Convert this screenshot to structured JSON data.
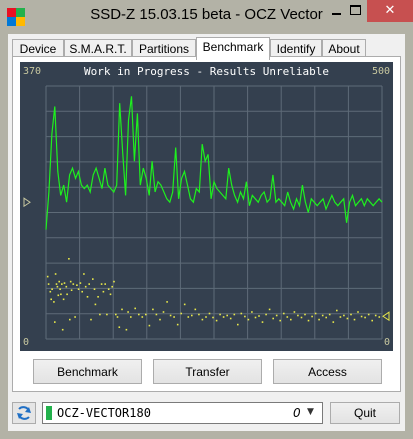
{
  "window": {
    "title": "SSD-Z 15.03.15 beta - OCZ Vector",
    "close_glyph": "✕",
    "colors": {
      "frame": "#b3b2a6",
      "close": "#c75050"
    }
  },
  "tabs": [
    {
      "label": "Device",
      "active": false
    },
    {
      "label": "S.M.A.R.T.",
      "active": false
    },
    {
      "label": "Partitions",
      "active": false
    },
    {
      "label": "Benchmark",
      "active": true
    },
    {
      "label": "Identify",
      "active": false
    },
    {
      "label": "About",
      "active": false
    }
  ],
  "chart": {
    "title": "Work in Progress - Results Unreliable",
    "left_top": "370",
    "left_bottom": "0",
    "right_top": "500",
    "right_bottom": "0",
    "colors": {
      "background": "#34404f",
      "grid": "#5e6b78",
      "line": "#1ef01e",
      "dots": "#e8e84a"
    }
  },
  "chart_data": {
    "type": "line",
    "title": "Work in Progress - Results Unreliable",
    "left_axis_range": [
      0,
      370
    ],
    "right_axis_range": [
      0,
      500
    ],
    "grid": true,
    "series": [
      {
        "style": "line",
        "color": "#1ef01e",
        "values": [
          160,
          215,
          300,
          340,
          245,
          210,
          225,
          200,
          240,
          250,
          235,
          245,
          225,
          220,
          225,
          215,
          240,
          250,
          235,
          220,
          250,
          225,
          220,
          215,
          225,
          345,
          275,
          210,
          320,
          355,
          260,
          330,
          225,
          250,
          235,
          210,
          260,
          215,
          230,
          225,
          215,
          205,
          200,
          215,
          280,
          205,
          235,
          245,
          225,
          205,
          200,
          220,
          215,
          285,
          260,
          270,
          205,
          230,
          220,
          215,
          210,
          205,
          250,
          225,
          210,
          200,
          215,
          205,
          230,
          195,
          210,
          205,
          200,
          210,
          215,
          200,
          205,
          240,
          200,
          205,
          200,
          195,
          215,
          200,
          190,
          205,
          195,
          225,
          200,
          185,
          205,
          200,
          195,
          200,
          205,
          190,
          200,
          210,
          200,
          195,
          200,
          205,
          170,
          200,
          210,
          195,
          200,
          205,
          195,
          205,
          200,
          195,
          200,
          205,
          200
        ]
      },
      {
        "style": "scatter",
        "color": "#e8e84a",
        "points": [
          [
            1,
            125
          ],
          [
            2,
            110
          ],
          [
            4,
            95
          ],
          [
            5,
            80
          ],
          [
            6,
            100
          ],
          [
            8,
            75
          ],
          [
            9,
            35
          ],
          [
            10,
            130
          ],
          [
            11,
            110
          ],
          [
            12,
            105
          ],
          [
            13,
            88
          ],
          [
            14,
            115
          ],
          [
            15,
            100
          ],
          [
            16,
            90
          ],
          [
            17,
            110
          ],
          [
            18,
            20
          ],
          [
            19,
            80
          ],
          [
            20,
            112
          ],
          [
            22,
            105
          ],
          [
            23,
            90
          ],
          [
            25,
            160
          ],
          [
            26,
            40
          ],
          [
            27,
            115
          ],
          [
            28,
            98
          ],
          [
            30,
            110
          ],
          [
            32,
            45
          ],
          [
            34,
            108
          ],
          [
            36,
            100
          ],
          [
            38,
            112
          ],
          [
            40,
            95
          ],
          [
            42,
            130
          ],
          [
            44,
            105
          ],
          [
            46,
            85
          ],
          [
            48,
            110
          ],
          [
            50,
            40
          ],
          [
            52,
            120
          ],
          [
            54,
            100
          ],
          [
            55,
            70
          ],
          [
            58,
            85
          ],
          [
            60,
            50
          ],
          [
            62,
            110
          ],
          [
            64,
            95
          ],
          [
            66,
            110
          ],
          [
            68,
            50
          ],
          [
            70,
            100
          ],
          [
            72,
            90
          ],
          [
            74,
            105
          ],
          [
            76,
            115
          ],
          [
            78,
            50
          ],
          [
            80,
            45
          ],
          [
            82,
            25
          ],
          [
            85,
            60
          ],
          [
            90,
            20
          ],
          [
            92,
            55
          ],
          [
            95,
            45
          ],
          [
            100,
            62
          ],
          [
            104,
            50
          ],
          [
            108,
            45
          ],
          [
            112,
            50
          ],
          [
            116,
            28
          ],
          [
            120,
            60
          ],
          [
            124,
            50
          ],
          [
            128,
            40
          ],
          [
            132,
            55
          ],
          [
            136,
            75
          ],
          [
            140,
            48
          ],
          [
            144,
            45
          ],
          [
            148,
            30
          ],
          [
            152,
            52
          ],
          [
            156,
            70
          ],
          [
            160,
            45
          ],
          [
            164,
            48
          ],
          [
            168,
            60
          ],
          [
            172,
            50
          ],
          [
            176,
            40
          ],
          [
            180,
            45
          ],
          [
            184,
            52
          ],
          [
            188,
            44
          ],
          [
            192,
            38
          ],
          [
            196,
            50
          ],
          [
            200,
            45
          ],
          [
            204,
            48
          ],
          [
            208,
            42
          ],
          [
            212,
            50
          ],
          [
            216,
            30
          ],
          [
            220,
            52
          ],
          [
            224,
            46
          ],
          [
            228,
            40
          ],
          [
            232,
            55
          ],
          [
            236,
            44
          ],
          [
            240,
            47
          ],
          [
            244,
            35
          ],
          [
            248,
            50
          ],
          [
            252,
            60
          ],
          [
            256,
            42
          ],
          [
            260,
            48
          ],
          [
            264,
            38
          ],
          [
            268,
            52
          ],
          [
            272,
            45
          ],
          [
            276,
            40
          ],
          [
            280,
            55
          ],
          [
            284,
            48
          ],
          [
            288,
            44
          ],
          [
            292,
            50
          ],
          [
            296,
            38
          ],
          [
            300,
            46
          ],
          [
            304,
            52
          ],
          [
            308,
            40
          ],
          [
            312,
            48
          ],
          [
            316,
            44
          ],
          [
            320,
            50
          ],
          [
            324,
            35
          ],
          [
            328,
            58
          ],
          [
            332,
            45
          ],
          [
            336,
            48
          ],
          [
            340,
            42
          ],
          [
            344,
            50
          ],
          [
            348,
            40
          ],
          [
            352,
            55
          ],
          [
            356,
            46
          ],
          [
            360,
            44
          ],
          [
            364,
            50
          ],
          [
            368,
            38
          ],
          [
            372,
            48
          ],
          [
            376,
            45
          ]
        ]
      }
    ]
  },
  "buttons": {
    "benchmark": "Benchmark",
    "transfer": "Transfer",
    "access": "Access"
  },
  "drive_selector": {
    "name": "OCZ-VECTOR180",
    "count": "0",
    "arrow": "▼"
  },
  "quit": "Quit"
}
